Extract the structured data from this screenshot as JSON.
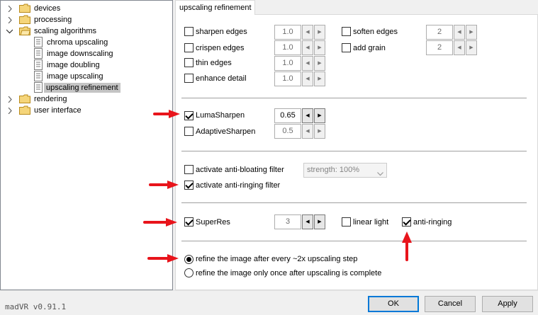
{
  "tree": {
    "items": [
      {
        "label": "devices",
        "kind": "folder",
        "expander": "collapsed"
      },
      {
        "label": "processing",
        "kind": "folder",
        "expander": "collapsed"
      },
      {
        "label": "scaling algorithms",
        "kind": "folder",
        "expander": "expanded"
      },
      {
        "label": "chroma upscaling",
        "kind": "page"
      },
      {
        "label": "image downscaling",
        "kind": "page"
      },
      {
        "label": "image doubling",
        "kind": "page"
      },
      {
        "label": "image upscaling",
        "kind": "page"
      },
      {
        "label": "upscaling refinement",
        "kind": "page",
        "selected": true
      },
      {
        "label": "rendering",
        "kind": "folder",
        "expander": "collapsed"
      },
      {
        "label": "user interface",
        "kind": "folder",
        "expander": "collapsed"
      }
    ]
  },
  "tab": {
    "title": "upscaling refinement"
  },
  "group1": {
    "left": [
      {
        "label": "sharpen edges",
        "checked": false,
        "value": "1.0"
      },
      {
        "label": "crispen edges",
        "checked": false,
        "value": "1.0"
      },
      {
        "label": "thin edges",
        "checked": false,
        "value": "1.0"
      },
      {
        "label": "enhance detail",
        "checked": false,
        "value": "1.0"
      }
    ],
    "right": [
      {
        "label": "soften edges",
        "checked": false,
        "value": "2"
      },
      {
        "label": "add grain",
        "checked": false,
        "value": "2"
      }
    ]
  },
  "group2": {
    "lumasharpen": {
      "label": "LumaSharpen",
      "checked": true,
      "value": "0.65"
    },
    "adaptivesharpen": {
      "label": "AdaptiveSharpen",
      "checked": false,
      "value": "0.5"
    }
  },
  "group3": {
    "antibloating": {
      "label": "activate anti-bloating filter",
      "checked": false,
      "strength": "strength: 100%"
    },
    "antiringing": {
      "label": "activate anti-ringing filter",
      "checked": true
    }
  },
  "group4": {
    "superres": {
      "label": "SuperRes",
      "checked": true,
      "value": "3"
    },
    "linearlight": {
      "label": "linear light",
      "checked": false
    },
    "antiringing": {
      "label": "anti-ringing",
      "checked": true
    }
  },
  "group5": {
    "refine_every": {
      "label": "refine the image after every ~2x upscaling step",
      "selected": true
    },
    "refine_once": {
      "label": "refine the image only once after upscaling is complete",
      "selected": false
    }
  },
  "footer": {
    "version": "madVR v0.91.1",
    "ok": "OK",
    "cancel": "Cancel",
    "apply": "Apply"
  },
  "colors": {
    "annotation_arrow": "#e8141b",
    "selection": "#cce8ff",
    "default_button": "#0078d7"
  }
}
